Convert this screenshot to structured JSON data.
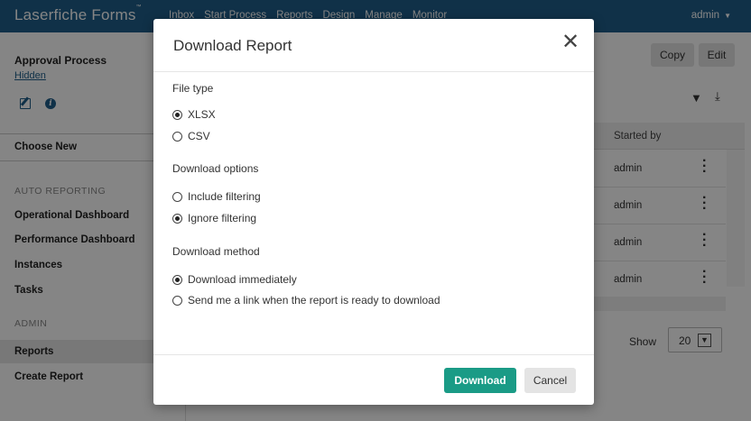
{
  "app": {
    "brand": "Laserfiche Forms",
    "trademark": "™"
  },
  "nav": [
    "Inbox",
    "Start Process",
    "Reports",
    "Design",
    "Manage",
    "Monitor"
  ],
  "user": {
    "name": "admin"
  },
  "sidebar": {
    "process_title": "Approval Process",
    "process_status": "Hidden",
    "choose_new": "Choose New",
    "auto_reporting_heading": "AUTO REPORTING",
    "auto_reporting_items": [
      "Operational Dashboard",
      "Performance Dashboard",
      "Instances",
      "Tasks"
    ],
    "admin_heading": "ADMIN",
    "admin_items": [
      "Reports",
      "Create Report"
    ]
  },
  "toolbar": {
    "copy_label": "Copy",
    "edit_label": "Edit"
  },
  "table": {
    "column_header": "Started by",
    "rows": [
      "admin",
      "admin",
      "admin",
      "admin"
    ]
  },
  "pagination": {
    "show_label": "Show",
    "page_size": "20"
  },
  "modal": {
    "title": "Download Report",
    "file_type_label": "File type",
    "file_type_options": [
      {
        "label": "XLSX",
        "selected": true
      },
      {
        "label": "CSV",
        "selected": false
      }
    ],
    "download_options_label": "Download options",
    "download_options": [
      {
        "label": "Include filtering",
        "selected": false
      },
      {
        "label": "Ignore filtering",
        "selected": true
      }
    ],
    "download_method_label": "Download method",
    "download_methods": [
      {
        "label": "Download immediately",
        "selected": true
      },
      {
        "label": "Send me a link when the report is ready to download",
        "selected": false
      }
    ],
    "download_button": "Download",
    "cancel_button": "Cancel"
  },
  "colors": {
    "topbar": "#1f5f8b",
    "primary_button": "#1a9b86"
  }
}
